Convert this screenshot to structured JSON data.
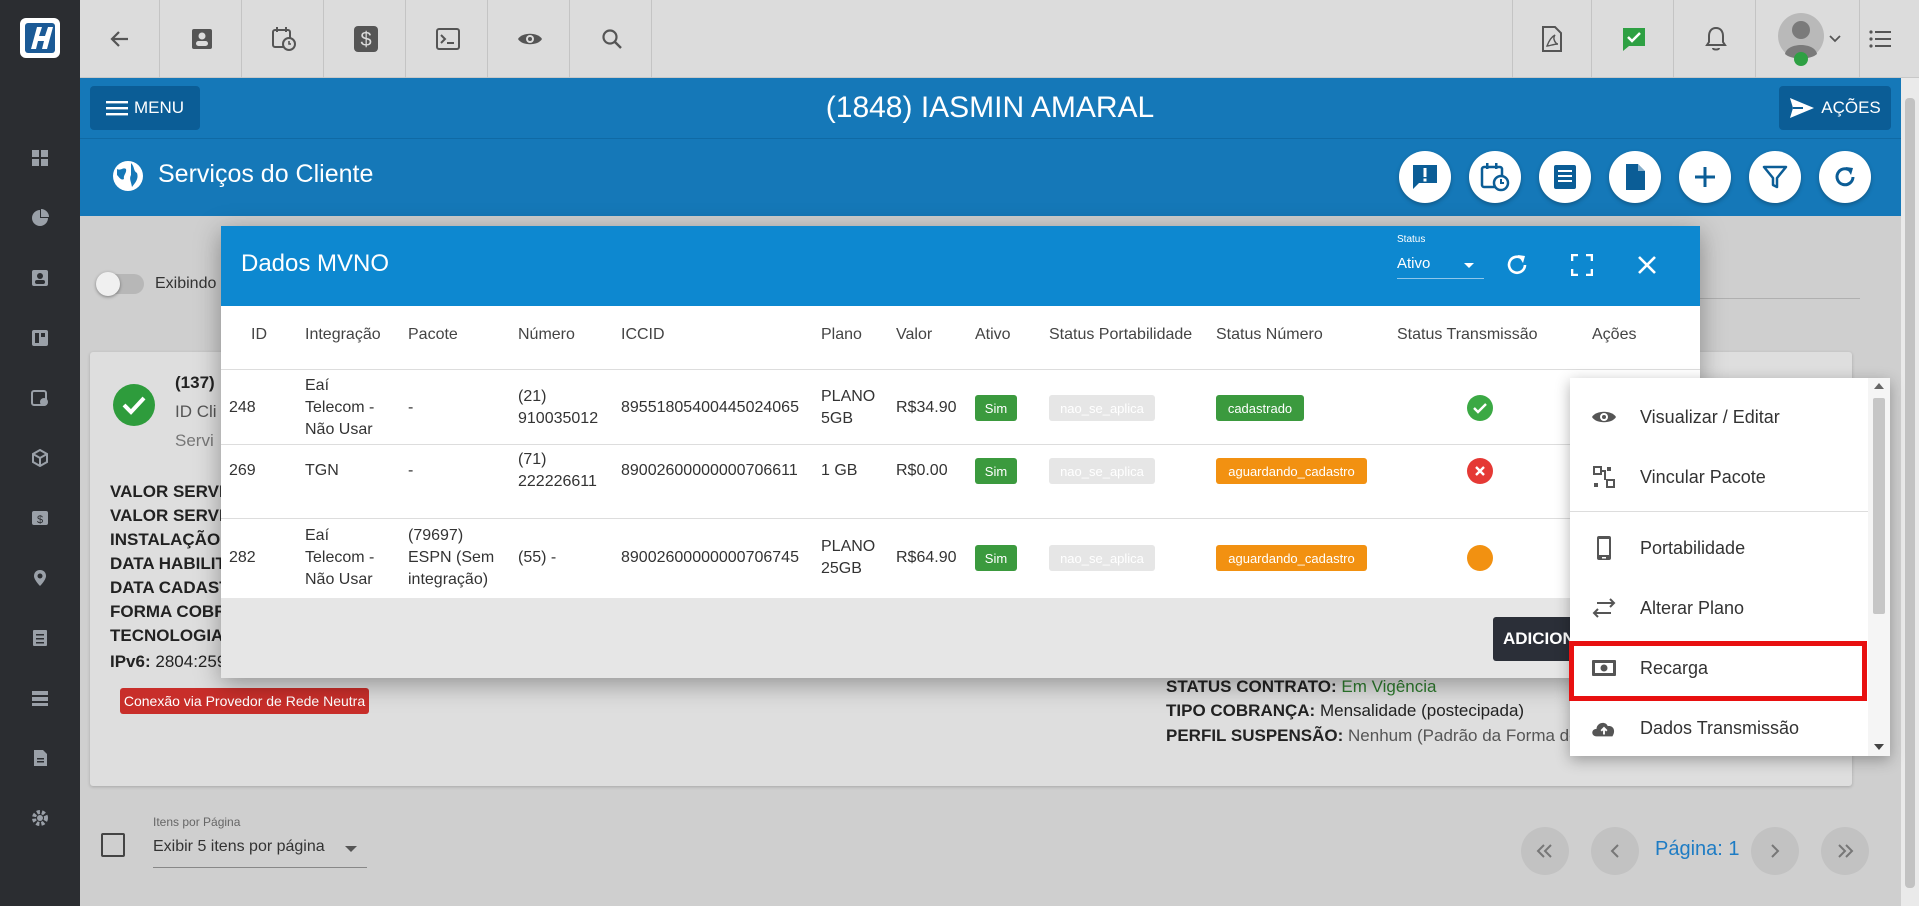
{
  "header": {
    "menu_label": "MENU",
    "client_name": "(1848) IASMIN AMARAL",
    "actions_label": "AÇÕES",
    "section_title": "Serviços do Cliente"
  },
  "background": {
    "toggle_label": "Exibindo",
    "card_id_line": "(137)",
    "card_id_client": "ID Cli",
    "card_service": "Servi",
    "lines": [
      "VALOR SERVIC",
      "VALOR SERVIC",
      "INSTALAÇÃO:",
      "DATA HABILIT",
      "DATA CADAST",
      "FORMA COBRA",
      "TECNOLOGIA"
    ],
    "ipv6_label": "IPv6:",
    "ipv6_value": "2804:259",
    "neutral_badge": "Conexão via Provedor de Rede Neutra",
    "status_contrato_label": "STATUS CONTRATO:",
    "status_contrato_value": "Em Vigência",
    "tipo_cobranca_label": "TIPO COBRANÇA:",
    "tipo_cobranca_value": "Mensalidade (postecipada)",
    "perfil_label": "PERFIL SUSPENSÃO:",
    "perfil_value": "Nenhum (Padrão da Forma de",
    "per_page_label": "Itens por Página",
    "per_page_value": "Exibir 5 itens por página",
    "page_label": "Página: 1"
  },
  "modal": {
    "title": "Dados MVNO",
    "status_label": "Status",
    "status_value": "Ativo",
    "add_button": "ADICION",
    "columns": [
      "ID",
      "Integração",
      "Pacote",
      "Número",
      "ICCID",
      "Plano",
      "Valor",
      "Ativo",
      "Status Portabilidade",
      "Status Número",
      "Status Transmissão",
      "Ações"
    ],
    "rows": [
      {
        "id": "248",
        "integracao": [
          "Eaí",
          "Telecom -",
          "Não Usar"
        ],
        "pacote": [
          "-"
        ],
        "numero": [
          "(21)",
          "910035012"
        ],
        "iccid": "89551805400445024065",
        "plano": [
          "PLANO",
          "5GB"
        ],
        "valor": "R$34.90",
        "ativo": "Sim",
        "portabilidade": "nao_se_aplica",
        "status_numero": "cadastrado",
        "transmissao": "ok"
      },
      {
        "id": "269",
        "integracao": [
          "TGN"
        ],
        "pacote": [
          "-"
        ],
        "numero": [
          "(71)",
          "222226611"
        ],
        "iccid": "89002600000000706611",
        "plano": [
          "1 GB"
        ],
        "valor": "R$0.00",
        "ativo": "Sim",
        "portabilidade": "nao_se_aplica",
        "status_numero": "aguardando_cadastro",
        "transmissao": "error"
      },
      {
        "id": "282",
        "integracao": [
          "Eaí",
          "Telecom -",
          "Não Usar"
        ],
        "pacote": [
          "(79697)",
          "ESPN (Sem",
          "integração)"
        ],
        "numero": [
          "(55) -"
        ],
        "iccid": "89002600000000706745",
        "plano": [
          "PLANO",
          "25GB"
        ],
        "valor": "R$64.90",
        "ativo": "Sim",
        "portabilidade": "nao_se_aplica",
        "status_numero": "aguardando_cadastro",
        "transmissao": "pending"
      }
    ]
  },
  "dropdown": {
    "items": [
      "Visualizar / Editar",
      "Vincular Pacote",
      "Portabilidade",
      "Alterar Plano",
      "Recarga",
      "Dados Transmissão"
    ],
    "highlighted": "Recarga"
  },
  "colors": {
    "header_blue": "#1578b8",
    "modal_blue": "#0d88d0",
    "success": "#3b9a3e",
    "warning": "#f29111",
    "danger": "#e53935",
    "highlight": "#e81010"
  }
}
